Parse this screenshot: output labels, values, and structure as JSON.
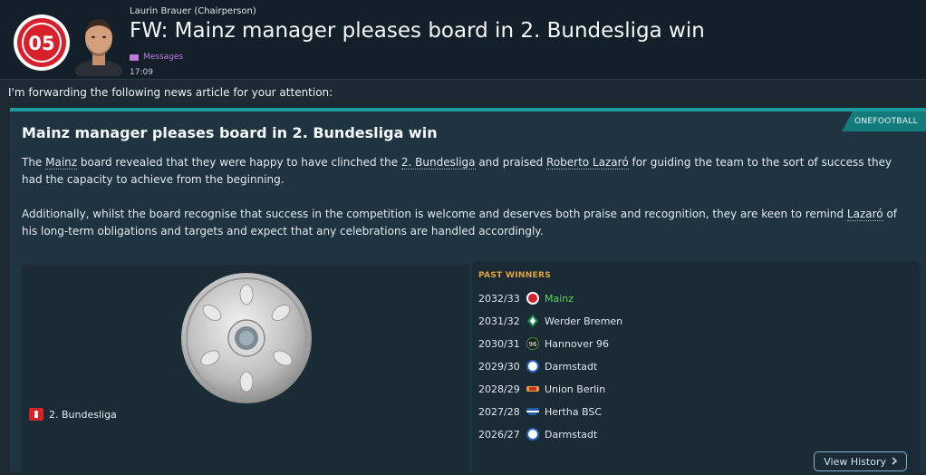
{
  "header": {
    "sender": "Laurin Brauer  (Chairperson)",
    "subject": "FW: Mainz manager pleases board in 2. Bundesliga win",
    "tag": "Messages",
    "time": "17:09",
    "club_badge_text": "05"
  },
  "intro": "I'm forwarding the following news article for your attention:",
  "article": {
    "source": "ONEFOOTBALL",
    "title": "Mainz manager pleases board in 2. Bundesliga win",
    "para1": {
      "t1": "The ",
      "club": "Mainz",
      "t2": " board revealed that they were happy to have clinched the ",
      "league": "2. Bundesliga",
      "t3": " and praised ",
      "manager": "Roberto Lazaró",
      "t4": " for guiding the team to the sort of success they had the capacity to achieve from the beginning."
    },
    "para2": {
      "t1": "Additionally, whilst the board recognise that success in the competition is welcome and deserves both praise and recognition, they are keen to remind ",
      "manager": "Lazaró",
      "t2": " of his long-term obligations and targets and expect that any celebrations are handled accordingly."
    }
  },
  "trophy": {
    "league_label": "2. Bundesliga",
    "league_icon": "bundesliga-icon"
  },
  "winners": {
    "header": "PAST WINNERS",
    "rows": [
      {
        "season": "2032/33",
        "club": "Mainz",
        "icon": "mainz-badge-icon",
        "color": "#d6202b",
        "highlight": "#5fd35f"
      },
      {
        "season": "2031/32",
        "club": "Werder Bremen",
        "icon": "werder-badge-icon",
        "color": "#1e8c4b"
      },
      {
        "season": "2030/31",
        "club": "Hannover 96",
        "icon": "hannover-badge-icon",
        "color": "#1d1d1d"
      },
      {
        "season": "2029/30",
        "club": "Darmstadt",
        "icon": "darmstadt-badge-icon",
        "color": "#2a64b8"
      },
      {
        "season": "2028/29",
        "club": "Union Berlin",
        "icon": "union-badge-icon",
        "color": "#e2a23a"
      },
      {
        "season": "2027/28",
        "club": "Hertha BSC",
        "icon": "hertha-badge-icon",
        "color": "#1f5fb0"
      },
      {
        "season": "2026/27",
        "club": "Darmstadt",
        "icon": "darmstadt-badge-icon",
        "color": "#2a64b8"
      }
    ],
    "button": "View History",
    "button_icon": "chevron-right-icon"
  },
  "colors": {
    "accent": "#1a9c9e",
    "winners_header": "#e0a53a",
    "current_winner": "#5fd35f"
  }
}
